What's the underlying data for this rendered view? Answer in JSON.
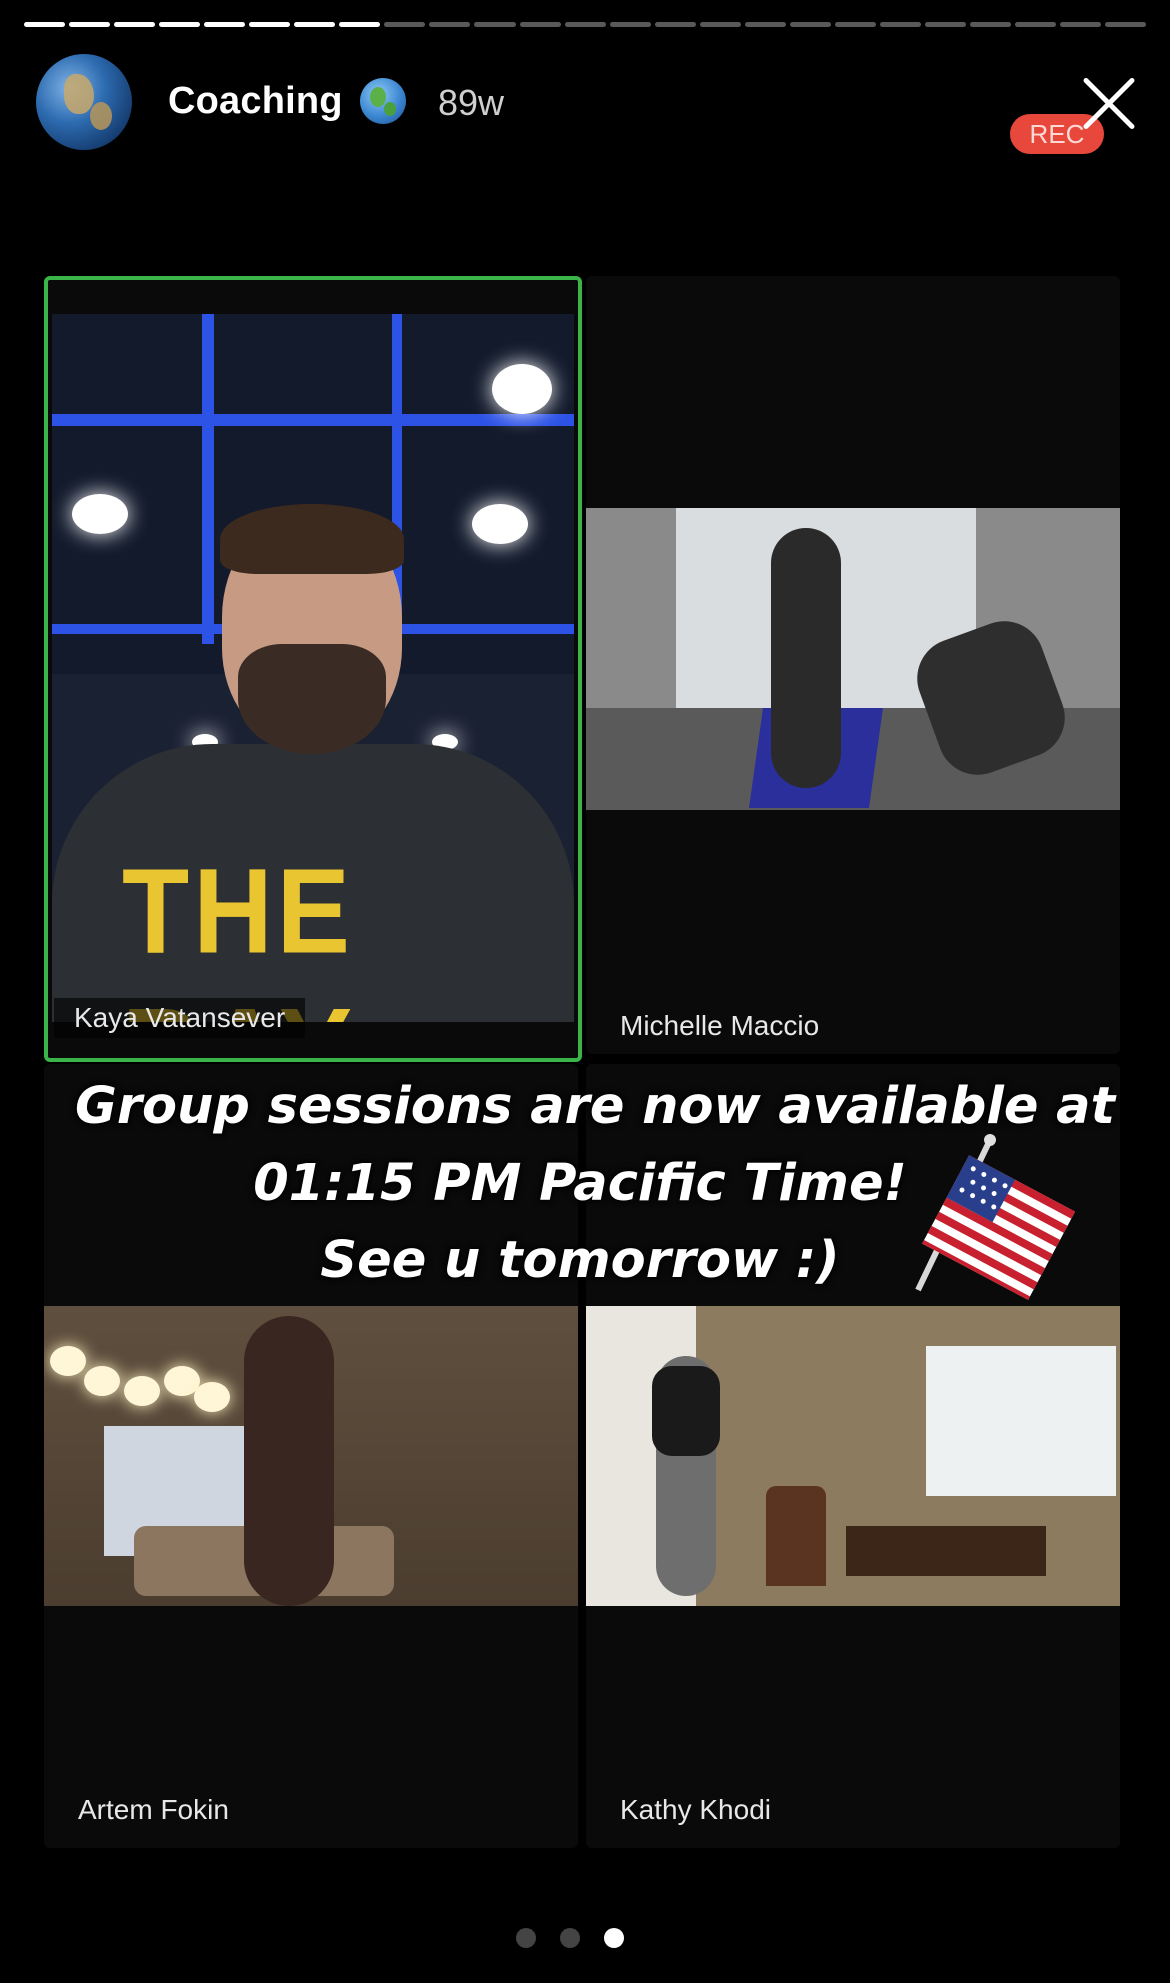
{
  "story": {
    "segments_total": 25,
    "segments_viewed": 8
  },
  "header": {
    "handle": "Coaching",
    "handle_emoji_icon": "globe-icon",
    "age": "89w",
    "close_icon": "close-icon"
  },
  "recording": {
    "label": "REC",
    "color": "#e8483b"
  },
  "meeting": {
    "participants": [
      {
        "name": "Kaya Vatansever",
        "active_speaker": true
      },
      {
        "name": "Michelle Maccio",
        "active_speaker": false
      },
      {
        "name": "Artem Fokin",
        "active_speaker": false
      },
      {
        "name": "Kathy Khodi",
        "active_speaker": false
      }
    ],
    "active_border_color": "#3bb54a"
  },
  "shirt_text": "THE BAY",
  "overlay": {
    "line1": "Group sessions are now available at",
    "line2": "01:15 PM Pacific Time!",
    "line3": "See u tomorrow :)",
    "sticker_icon": "us-flag-icon"
  },
  "pagination": {
    "count": 3,
    "active_index": 2
  }
}
